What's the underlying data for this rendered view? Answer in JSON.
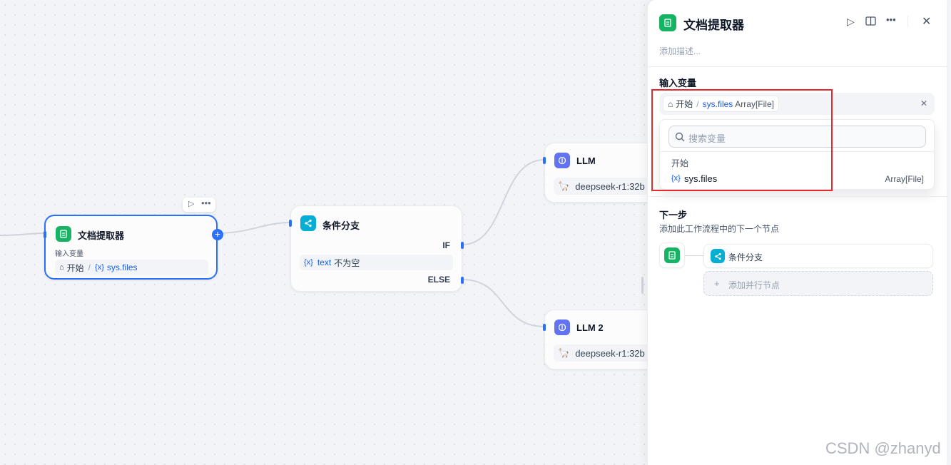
{
  "canvas": {
    "doc_node": {
      "title": "文档提取器",
      "var_label": "输入变量",
      "crumb_start": "开始",
      "crumb_sep": "/",
      "var_name": "sys.files"
    },
    "if_node": {
      "title": "条件分支",
      "if_label": "IF",
      "else_label": "ELSE",
      "cond_var": "text",
      "cond_op": "不为空"
    },
    "llm1": {
      "title": "LLM",
      "model": "deepseek-r1:32b"
    },
    "llm2": {
      "title": "LLM 2",
      "model": "deepseek-r1:32b"
    }
  },
  "panel": {
    "title": "文档提取器",
    "description_placeholder": "添加描述...",
    "input_section": "输入变量",
    "selected": {
      "start": "开始",
      "sep": "/",
      "var": "sys.files",
      "type": "Array[File]"
    },
    "search_placeholder": "搜索变量",
    "group_label": "开始",
    "option": {
      "name": "sys.files",
      "type": "Array[File]"
    },
    "next_step_title": "下一步",
    "next_step_desc": "添加此工作流程中的下一个节点",
    "next_node": "条件分支",
    "add_parallel": "添加并行节点"
  },
  "watermark": "CSDN @zhanyd",
  "colors": {
    "accent": "#2970ff",
    "green": "#16b364",
    "cyan": "#06aed4",
    "indigo": "#6172f3",
    "highlight": "#e5292d"
  }
}
